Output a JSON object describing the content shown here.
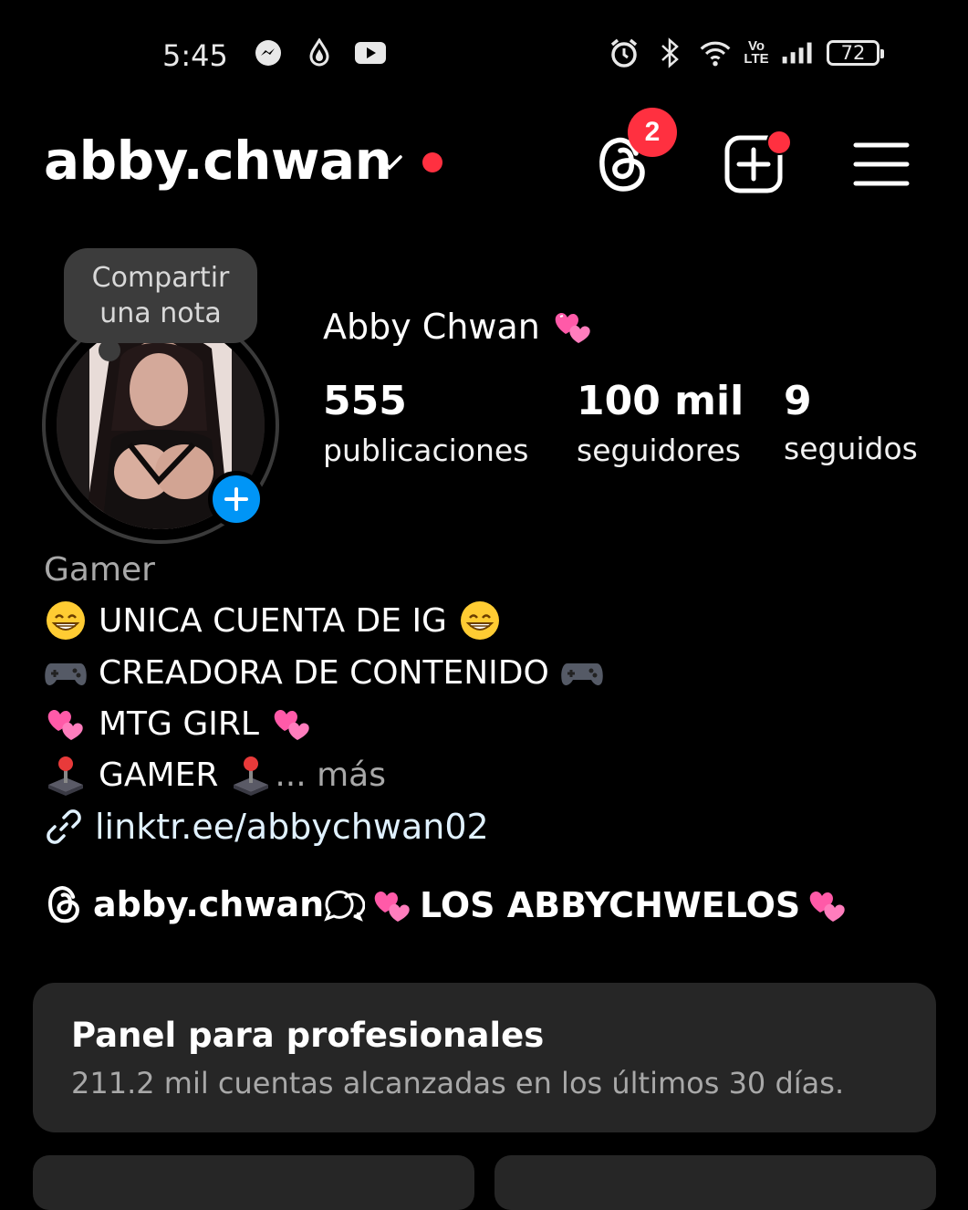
{
  "status_bar": {
    "time": "5:45",
    "left_icons": [
      "messenger-icon",
      "drops-icon",
      "youtube-icon"
    ],
    "right_icons": [
      "alarm-icon",
      "bluetooth-icon",
      "wifi-icon",
      "volte-icon",
      "signal-icon"
    ],
    "volte_text": "Vo LTE",
    "battery": "72"
  },
  "header": {
    "username": "abby.chwan",
    "threads_badge": "2",
    "icons": [
      "chevron-down-icon",
      "threads-icon",
      "create-icon",
      "menu-icon"
    ]
  },
  "profile": {
    "note_bubble_line1": "Compartir",
    "note_bubble_line2": "una nota",
    "full_name": "Abby Chwan",
    "name_emoji": "💞",
    "stats": {
      "posts_count": "555",
      "posts_label": "publicaciones",
      "followers_count": "100 mil",
      "followers_label": "seguidores",
      "following_count": "9",
      "following_label": "seguidos"
    }
  },
  "bio": {
    "category": "Gamer",
    "line1": "UNICA CUENTA DE IG",
    "line2": "CREADORA DE CONTENIDO",
    "line3": "MTG GIRL",
    "line4": "GAMER",
    "more": "... más",
    "link": "linktr.ee/abbychwan02"
  },
  "threads_link": {
    "label": "abby.chwan"
  },
  "channel": {
    "label": "LOS ABBYCHWELOS"
  },
  "pro_panel": {
    "title": "Panel para profesionales",
    "subtitle": "211.2 mil cuentas alcanzadas en los últimos 30 días."
  },
  "colors": {
    "background": "#000000",
    "accent_blue": "#0095f6",
    "notification_red": "#ff3040",
    "panel_bg": "#262626",
    "muted_text": "#a8a8a8"
  }
}
